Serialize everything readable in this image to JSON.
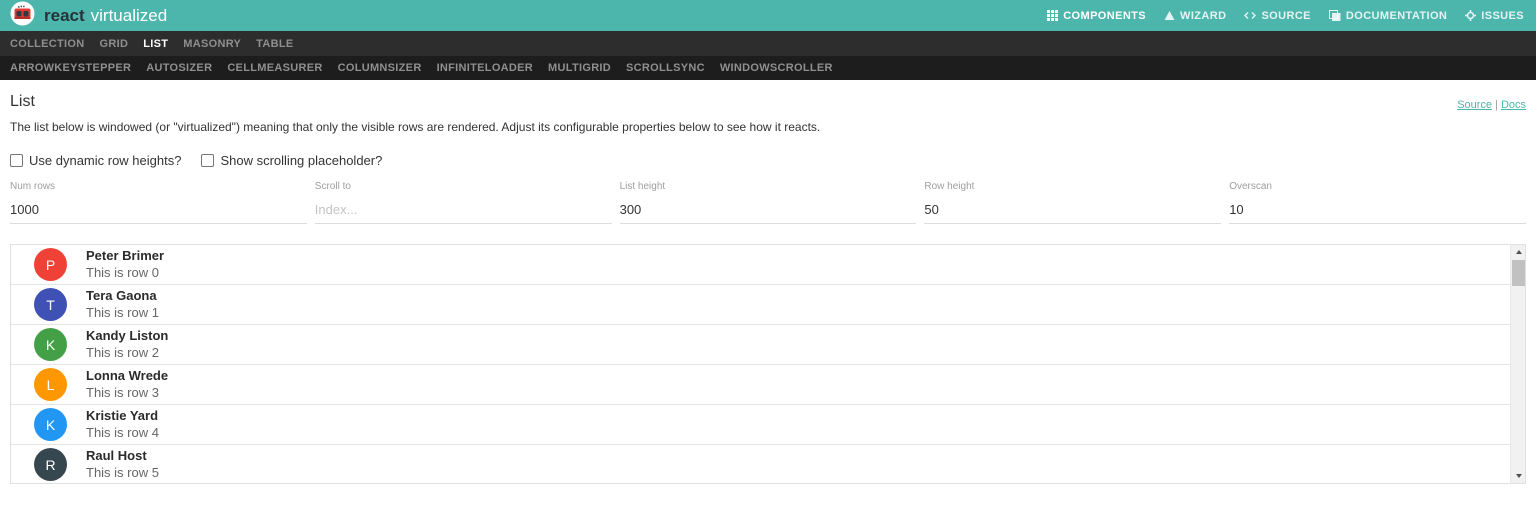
{
  "colors": {
    "accent_teal": "#4db6ac",
    "header_bg": "#4db6ac",
    "nav_primary_bg": "#2d2d2d",
    "nav_secondary_bg": "#1d1d1d",
    "scroll_track": "#f1f1f1",
    "scroll_thumb": "#c1c1c1"
  },
  "header": {
    "brand": {
      "first": "react",
      "second": "virtualized"
    },
    "nav": [
      {
        "label": "COMPONENTS",
        "icon": "grid-icon",
        "active": true
      },
      {
        "label": "WIZARD",
        "icon": "wizard-icon",
        "active": false
      },
      {
        "label": "SOURCE",
        "icon": "code-icon",
        "active": false
      },
      {
        "label": "DOCUMENTATION",
        "icon": "docs-icon",
        "active": false
      },
      {
        "label": "ISSUES",
        "icon": "gear-icon",
        "active": false
      }
    ]
  },
  "component_nav": {
    "primary": [
      {
        "label": "COLLECTION",
        "active": false
      },
      {
        "label": "GRID",
        "active": false
      },
      {
        "label": "LIST",
        "active": true
      },
      {
        "label": "MASONRY",
        "active": false
      },
      {
        "label": "TABLE",
        "active": false
      }
    ],
    "secondary": [
      {
        "label": "ARROWKEYSTEPPER",
        "active": false
      },
      {
        "label": "AUTOSIZER",
        "active": false
      },
      {
        "label": "CELLMEASURER",
        "active": false
      },
      {
        "label": "COLUMNSIZER",
        "active": false
      },
      {
        "label": "INFINITELOADER",
        "active": false
      },
      {
        "label": "MULTIGRID",
        "active": false
      },
      {
        "label": "SCROLLSYNC",
        "active": false
      },
      {
        "label": "WINDOWSCROLLER",
        "active": false
      }
    ]
  },
  "page": {
    "title": "List",
    "links": {
      "source": "Source",
      "separator": "|",
      "docs": "Docs"
    },
    "description": "The list below is windowed (or \"virtualized\") meaning that only the visible rows are rendered. Adjust its configurable properties below to see how it reacts.",
    "checkboxes": [
      {
        "label": "Use dynamic row heights?",
        "checked": false
      },
      {
        "label": "Show scrolling placeholder?",
        "checked": false
      }
    ],
    "fields": [
      {
        "label": "Num rows",
        "value": "1000",
        "placeholder": ""
      },
      {
        "label": "Scroll to",
        "value": "",
        "placeholder": "Index..."
      },
      {
        "label": "List height",
        "value": "300",
        "placeholder": ""
      },
      {
        "label": "Row height",
        "value": "50",
        "placeholder": ""
      },
      {
        "label": "Overscan",
        "value": "10",
        "placeholder": ""
      }
    ]
  },
  "list": {
    "rows": [
      {
        "initial": "P",
        "color": "#ef4136",
        "name": "Peter Brimer",
        "subtitle": "This is row 0"
      },
      {
        "initial": "T",
        "color": "#3f51b5",
        "name": "Tera Gaona",
        "subtitle": "This is row 1"
      },
      {
        "initial": "K",
        "color": "#43a047",
        "name": "Kandy Liston",
        "subtitle": "This is row 2"
      },
      {
        "initial": "L",
        "color": "#ff9800",
        "name": "Lonna Wrede",
        "subtitle": "This is row 3"
      },
      {
        "initial": "K",
        "color": "#2196f3",
        "name": "Kristie Yard",
        "subtitle": "This is row 4"
      },
      {
        "initial": "R",
        "color": "#37474f",
        "name": "Raul Host",
        "subtitle": "This is row 5"
      }
    ]
  }
}
